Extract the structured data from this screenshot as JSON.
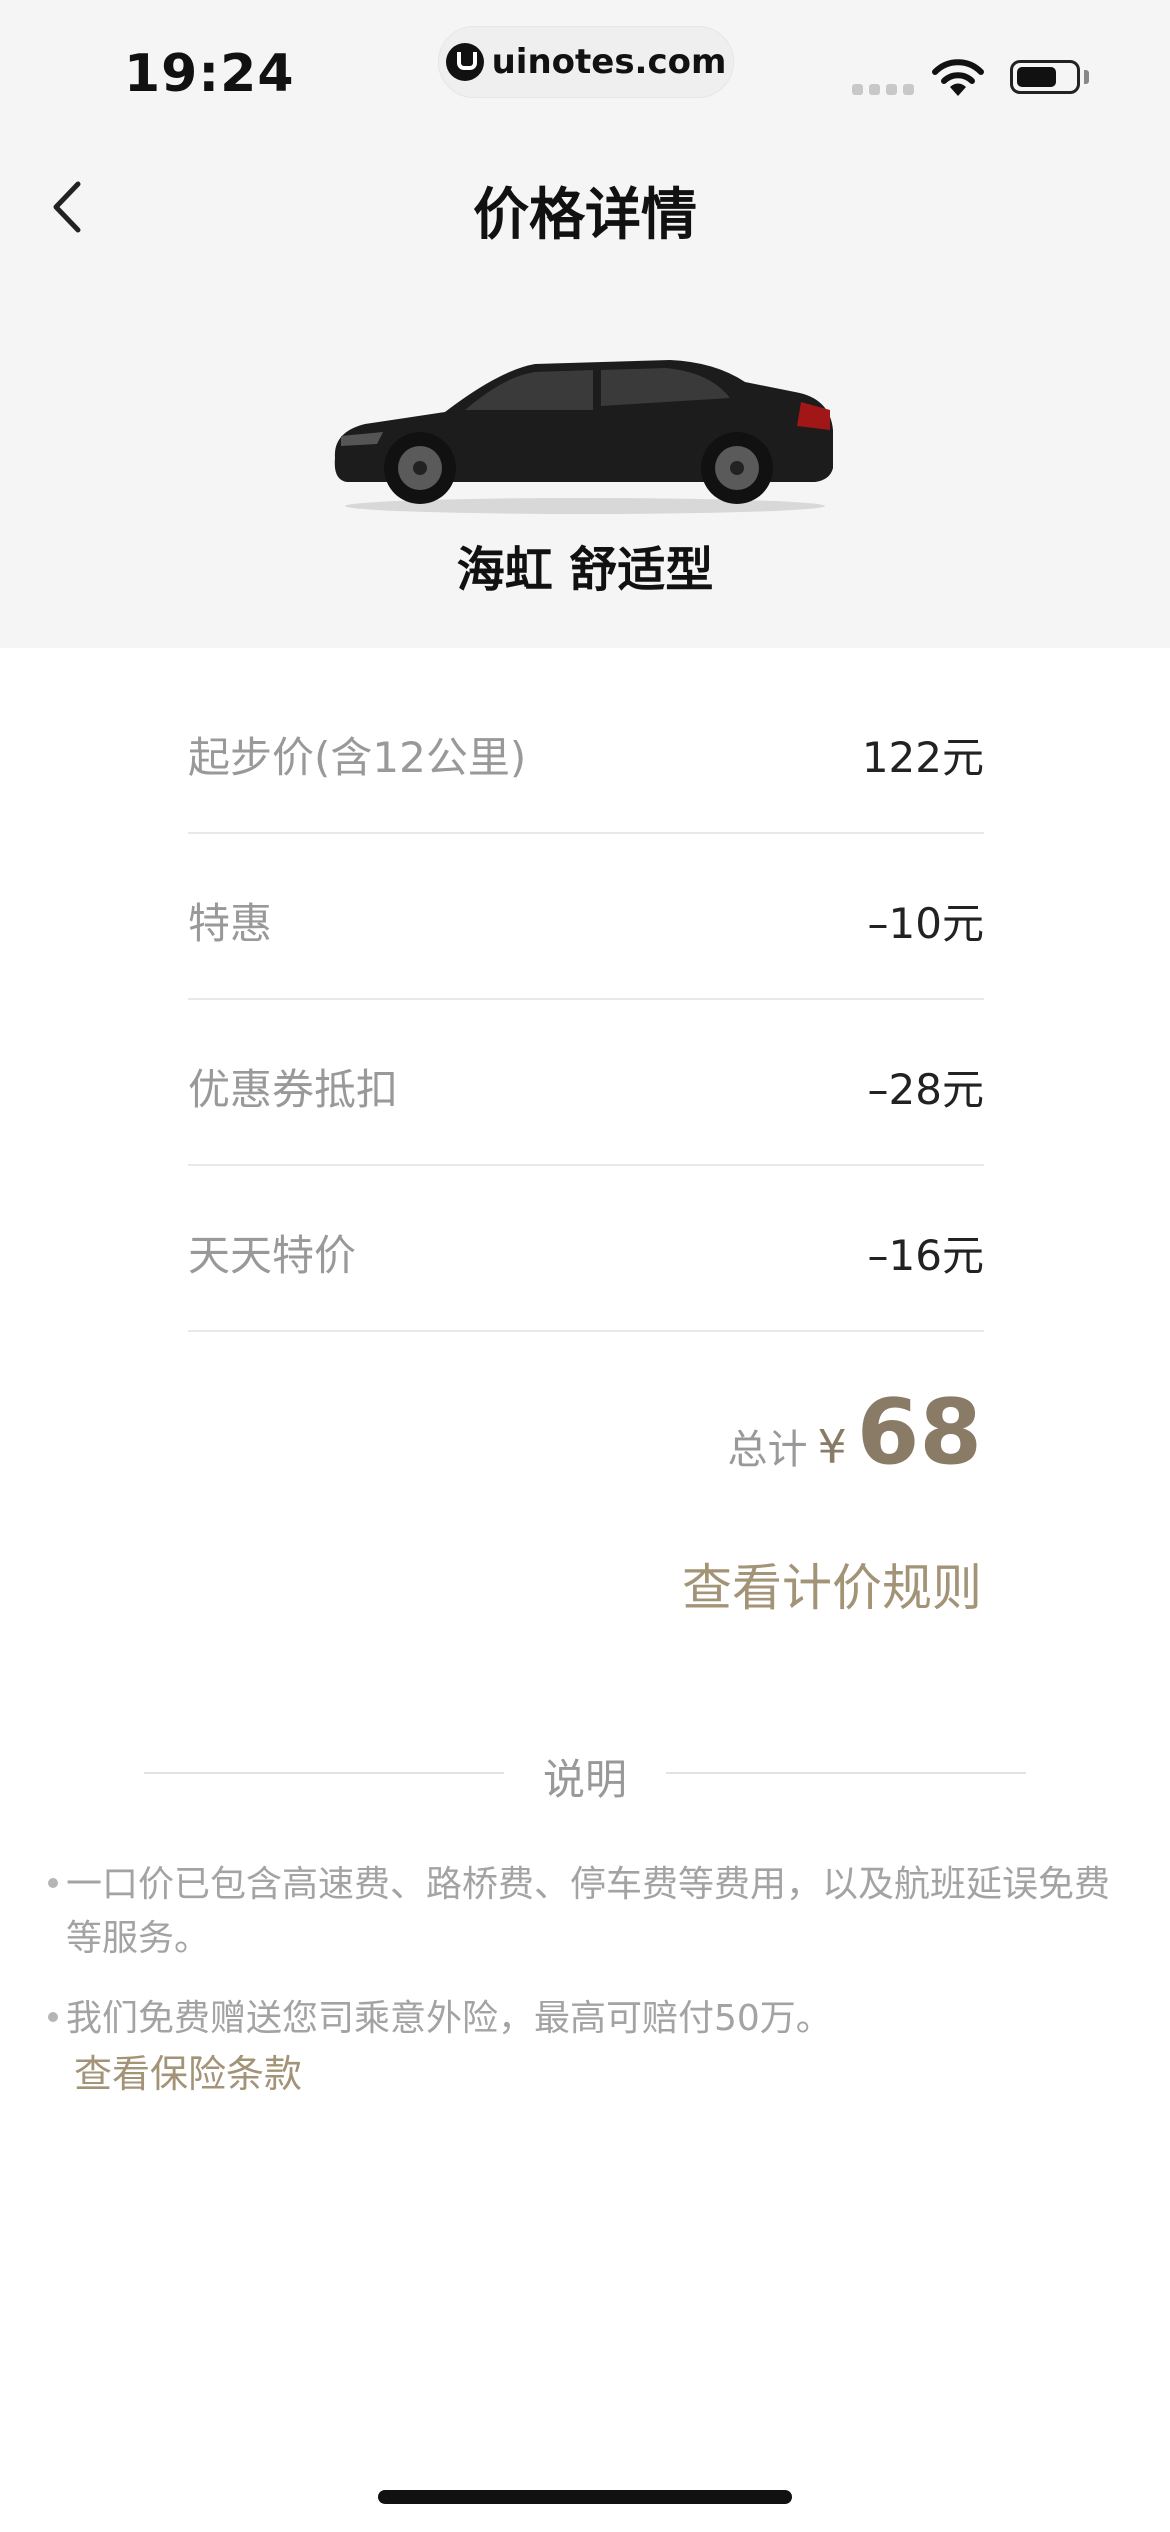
{
  "status_bar": {
    "time": "19:24",
    "url": "uinotes.com",
    "signal_icon": "cellular-signal-icon",
    "wifi_icon": "wifi-icon",
    "battery_icon": "battery-icon",
    "battery_level": 0.7
  },
  "header": {
    "title": "价格详情",
    "back_icon": "chevron-left-icon"
  },
  "car": {
    "name": "海虹 舒适型",
    "image": "black-sedan-car"
  },
  "price_items": [
    {
      "label": "起步价(含12公里)",
      "value": "122元"
    },
    {
      "label": "特惠",
      "value": "–10元"
    },
    {
      "label": "优惠券抵扣",
      "value": "–28元"
    },
    {
      "label": "天天特价",
      "value": "–16元"
    }
  ],
  "total": {
    "label": "总计",
    "currency": "¥",
    "amount": "68"
  },
  "rules_link": "查看计价规则",
  "notes_section": {
    "title": "说明",
    "items": [
      {
        "text": "一口价已包含高速费、路桥费、停车费等费用，以及航班延误免费等服务。"
      },
      {
        "text": "我们免费赠送您司乘意外险，最高可赔付50万。",
        "link": "查看保险条款"
      }
    ]
  },
  "colors": {
    "accent": "#8a7b66",
    "link": "#a39377",
    "header_bg": "#f5f5f5"
  }
}
